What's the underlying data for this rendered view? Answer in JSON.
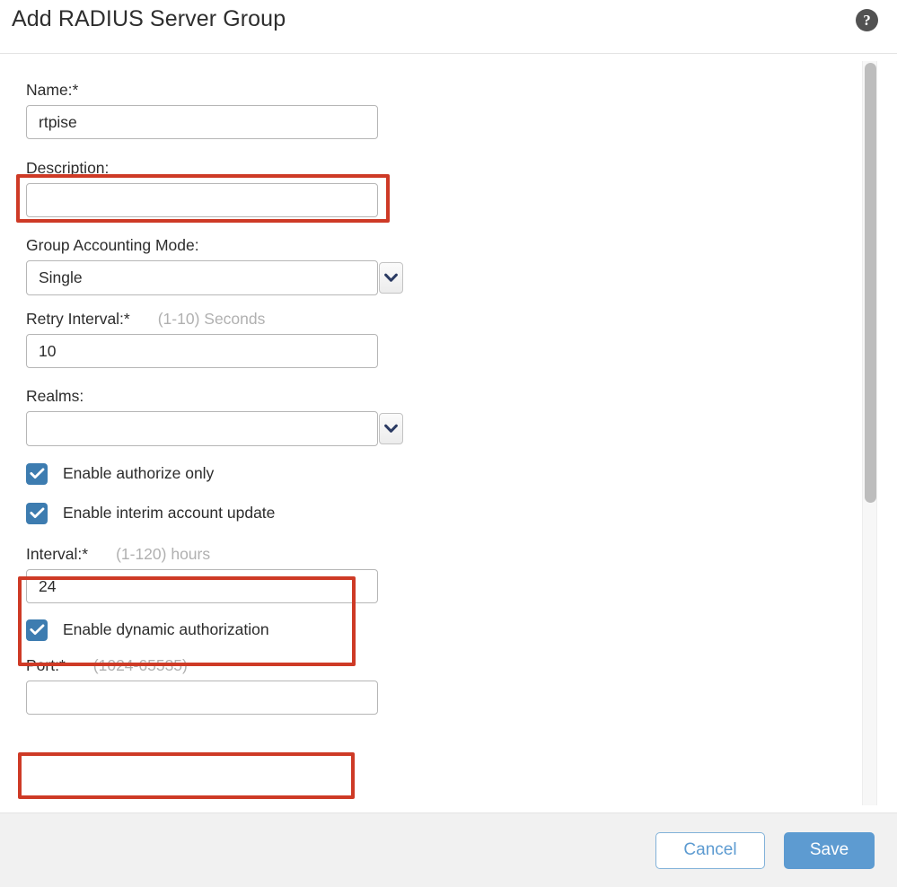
{
  "dialog": {
    "title": "Add RADIUS Server Group",
    "help_icon_label": "?"
  },
  "form": {
    "name": {
      "label": "Name:*",
      "value": "rtpise",
      "placeholder": ""
    },
    "description": {
      "label": "Description:",
      "value": "",
      "placeholder": ""
    },
    "group_accounting_mode": {
      "label": "Group Accounting Mode:",
      "value": "Single",
      "options": [
        "Single"
      ]
    },
    "retry_interval": {
      "label": "Retry Interval:*",
      "hint": "(1-10) Seconds",
      "value": "10"
    },
    "realms": {
      "label": "Realms:",
      "value": "",
      "options": []
    },
    "enable_authorize_only": {
      "label": "Enable authorize only",
      "checked": true
    },
    "enable_interim_account_update": {
      "label": "Enable interim account update",
      "checked": true
    },
    "interval": {
      "label": "Interval:*",
      "hint": "(1-120) hours",
      "value": "24"
    },
    "enable_dynamic_authorization": {
      "label": "Enable dynamic authorization",
      "checked": true
    },
    "port": {
      "label": "Port:*",
      "hint": "(1024-65535)",
      "value": ""
    }
  },
  "footer": {
    "cancel_label": "Cancel",
    "save_label": "Save"
  },
  "colors": {
    "highlight_red": "#ce3a26",
    "accent_blue": "#5d9bd1",
    "checkbox_blue": "#3d7cb0",
    "footer_bg": "#f1f1f1",
    "hint_gray": "#b0b0b0"
  }
}
